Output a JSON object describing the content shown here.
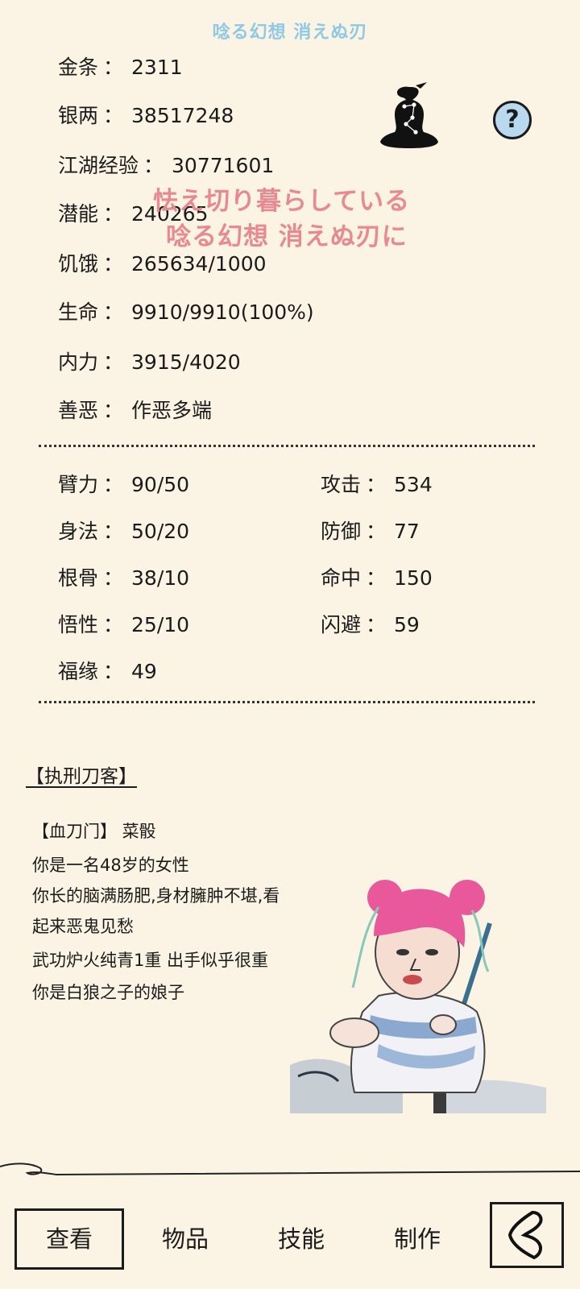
{
  "lyrics": {
    "top": "唸る幻想 消えぬ刃",
    "line1": "怯え切り暮らしている",
    "line2": "唸る幻想 消えぬ刃に"
  },
  "stats": [
    {
      "label": "金条",
      "value": "2311"
    },
    {
      "label": "银两",
      "value": "38517248"
    },
    {
      "label": "江湖经验",
      "value": "30771601"
    },
    {
      "label": "潜能",
      "value": "240265"
    },
    {
      "label": "饥饿",
      "value": "265634/1000"
    },
    {
      "label": "生命",
      "value": "9910/9910(100%)"
    },
    {
      "label": "内力",
      "value": "3915/4020"
    },
    {
      "label": "善恶",
      "value": "作恶多端"
    }
  ],
  "help_label": "?",
  "separator": "：",
  "attributes_left": [
    {
      "label": "臂力",
      "value": "90/50"
    },
    {
      "label": "身法",
      "value": "50/20"
    },
    {
      "label": "根骨",
      "value": "38/10"
    },
    {
      "label": "悟性",
      "value": "25/10"
    },
    {
      "label": "福缘",
      "value": "49"
    }
  ],
  "attributes_right": [
    {
      "label": "攻击",
      "value": "534"
    },
    {
      "label": "防御",
      "value": "77"
    },
    {
      "label": "命中",
      "value": "150"
    },
    {
      "label": "闪避",
      "value": "59"
    }
  ],
  "title_tag": "【执刑刀客】",
  "description": [
    "【血刀门】 菜骰",
    "你是一名48岁的女性",
    "你长的脑满肠肥,身材臃肿不堪,看",
    "起来恶鬼见愁",
    "武功炉火纯青1重 出手似乎很重",
    "你是白狼之子的娘子"
  ],
  "nav": {
    "view": "查看",
    "items": "物品",
    "skills": "技能",
    "craft": "制作"
  }
}
